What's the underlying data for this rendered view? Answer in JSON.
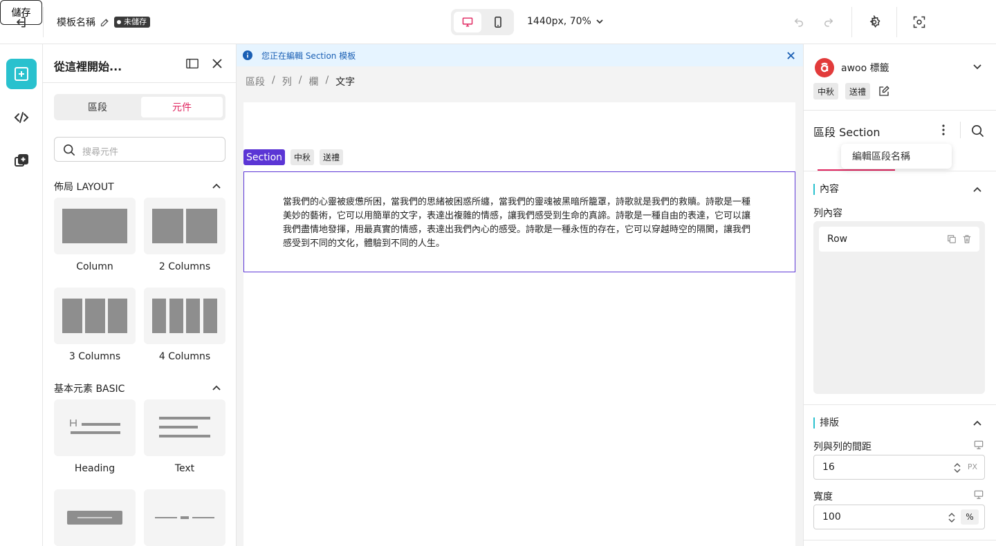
{
  "topbar": {
    "template_name": "模板名稱",
    "unsaved_label": "未儲存",
    "viewport_label": "1440px, 70%",
    "save_label": "儲存"
  },
  "panel": {
    "title": "從這裡開始...",
    "tabs": [
      "區段",
      "元件"
    ],
    "search_placeholder": "搜尋元件",
    "layout_group": "佈局 LAYOUT",
    "layout_items": [
      "Column",
      "2 Columns",
      "3 Columns",
      "4 Columns"
    ],
    "basic_group": "基本元素 BASIC",
    "basic_items": [
      "Heading",
      "Text"
    ]
  },
  "canvas": {
    "banner": "您正在編輯 Section 模板",
    "breadcrumb": [
      "區段",
      "列",
      "欄",
      "文字"
    ],
    "tags": [
      "Section",
      "中秋",
      "送禮"
    ],
    "poem": "當我們的心靈被疲憊所困，當我們的思緒被困惑所纏，當我們的靈魂被黑暗所籠罩，詩歌就是我們的救贖。詩歌是一種美妙的藝術，它可以用簡單的文字，表達出複雜的情感，讓我們感受到生命的真諦。詩歌是一種自由的表達，它可以讓我們盡情地發揮，用最真實的情感，表達出我們內心的感受。詩歌是一種永恆的存在，它可以穿越時空的隔閡，讓我們感受到不同的文化，體驗到不同的人生。"
  },
  "right": {
    "brand_name": "awoo 標籤",
    "brand_tags": [
      "中秋",
      "送禮"
    ],
    "section_title": "區段 Section",
    "rename_label": "編輯區段名稱",
    "content_title": "內容",
    "row_content_label": "列內容",
    "row_item": "Row",
    "layout_title": "排版",
    "gap_label": "列與列的間距",
    "gap_value": "16",
    "gap_unit": "PX",
    "width_label": "寬度",
    "width_value": "100",
    "width_unit": "%"
  },
  "colors": {
    "accent": "#29c1ce",
    "primary": "#5b35d5",
    "active_tab": "#e0245e",
    "brand": "#e23b3b"
  }
}
